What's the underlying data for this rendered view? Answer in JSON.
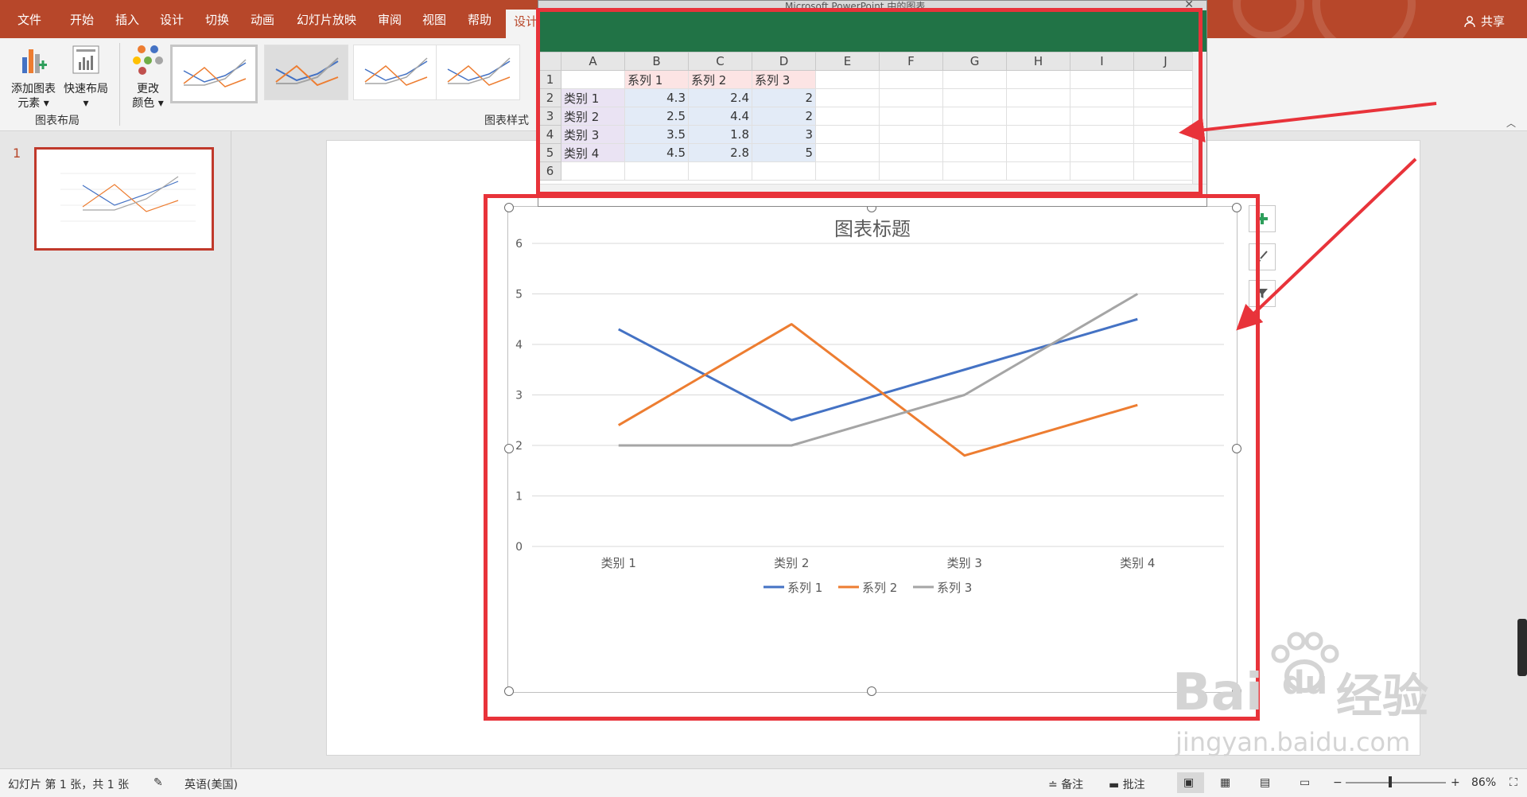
{
  "ribbon_tabs": [
    "文件",
    "开始",
    "插入",
    "设计",
    "切换",
    "动画",
    "幻灯片放映",
    "审阅",
    "视图",
    "帮助",
    "设计"
  ],
  "share_label": "共享",
  "ribbon": {
    "add_element_l1": "添加图表",
    "add_element_l2": "元素",
    "quick_layout": "快速布局",
    "change_color_l1": "更改",
    "change_color_l2": "颜色",
    "group_layout": "图表布局",
    "group_styles": "图表样式"
  },
  "slide_number": "1",
  "spreadsheet": {
    "title": "Microsoft PowerPoint 中的图表",
    "columns": [
      "A",
      "B",
      "C",
      "D",
      "E",
      "F",
      "G",
      "H",
      "I",
      "J"
    ],
    "row_numbers": [
      "1",
      "2",
      "3",
      "4",
      "5",
      "6"
    ],
    "rows": [
      [
        "",
        "系列 1",
        "系列 2",
        "系列 3"
      ],
      [
        "类别 1",
        "4.3",
        "2.4",
        "2"
      ],
      [
        "类别 2",
        "2.5",
        "4.4",
        "2"
      ],
      [
        "类别 3",
        "3.5",
        "1.8",
        "3"
      ],
      [
        "类别 4",
        "4.5",
        "2.8",
        "5"
      ]
    ]
  },
  "chart_data": {
    "type": "line",
    "title": "图表标题",
    "categories": [
      "类别 1",
      "类别 2",
      "类别 3",
      "类别 4"
    ],
    "series": [
      {
        "name": "系列 1",
        "color": "#4472c4",
        "values": [
          4.3,
          2.5,
          3.5,
          4.5
        ]
      },
      {
        "name": "系列 2",
        "color": "#ed7d31",
        "values": [
          2.4,
          4.4,
          1.8,
          2.8
        ]
      },
      {
        "name": "系列 3",
        "color": "#a5a5a5",
        "values": [
          2,
          2,
          3,
          5
        ]
      }
    ],
    "yticks": [
      "0",
      "1",
      "2",
      "3",
      "4",
      "5",
      "6"
    ],
    "ylim": [
      0,
      6
    ],
    "grid": true,
    "legend": "bottom"
  },
  "status": {
    "slide_info": "幻灯片 第 1 张，共 1 张",
    "language": "英语(美国)",
    "notes": "备注",
    "comments": "批注",
    "zoom": "86%"
  },
  "watermark": {
    "brand_left": "Bai",
    "brand_right": "du",
    "brand_cn": "经验",
    "url": "jingyan.baidu.com"
  }
}
